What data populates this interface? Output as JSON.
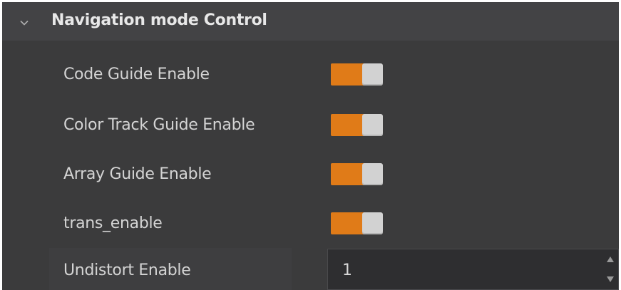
{
  "section": {
    "title": "Navigation mode Control",
    "expanded": true,
    "icon": "chevron-down-icon"
  },
  "settings": [
    {
      "label": "Code Guide Enable",
      "type": "toggle",
      "value": true
    },
    {
      "label": "Color Track Guide Enable",
      "type": "toggle",
      "value": true
    },
    {
      "label": "Array Guide Enable",
      "type": "toggle",
      "value": true
    },
    {
      "label": "trans_enable",
      "type": "toggle",
      "value": true
    }
  ],
  "undistort": {
    "label": "Undistort Enable",
    "value": "1",
    "up_icon": "spin-up-icon",
    "down_icon": "spin-down-icon"
  },
  "colors": {
    "panel_bg": "#3b3b3c",
    "header_bg": "#434345",
    "toggle_on": "#e07b18",
    "toggle_knob": "#d2d2d2",
    "text": "#d4d4d4"
  }
}
